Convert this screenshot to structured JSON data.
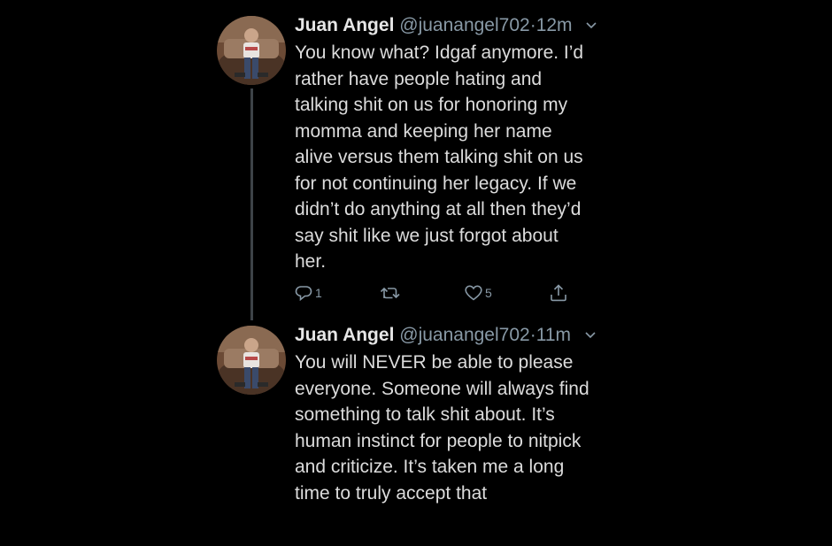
{
  "colors": {
    "background": "#000000",
    "text": "#dcdcdc",
    "secondary": "#8899a6",
    "thread_line": "#3d4348"
  },
  "tweets": [
    {
      "name": "Juan Angel",
      "handle": "@juanangel702",
      "separator": "·",
      "time": "12m",
      "text": "You know what? Idgaf anymore. I’d\nrather have people hating and\ntalking shit on us for honoring my\nmomma and keeping her name\nalive versus them talking shit on us\nfor not continuing her legacy. If we\ndidn’t do anything at all then they’d\nsay shit like we just forgot about\nher.",
      "reply_count": "1",
      "like_count": "5"
    },
    {
      "name": "Juan Angel",
      "handle": "@juanangel702",
      "separator": "·",
      "time": "11m",
      "text": "You will NEVER be able to please\neveryone. Someone will always find\nsomething to talk shit about. It’s\nhuman instinct for people to nitpick\nand criticize. It’s taken me a long\ntime to truly accept that"
    }
  ],
  "icons": {
    "reply": "reply-icon",
    "retweet": "retweet-icon",
    "like": "heart-icon",
    "share": "share-icon",
    "caret": "chevron-down-icon"
  }
}
